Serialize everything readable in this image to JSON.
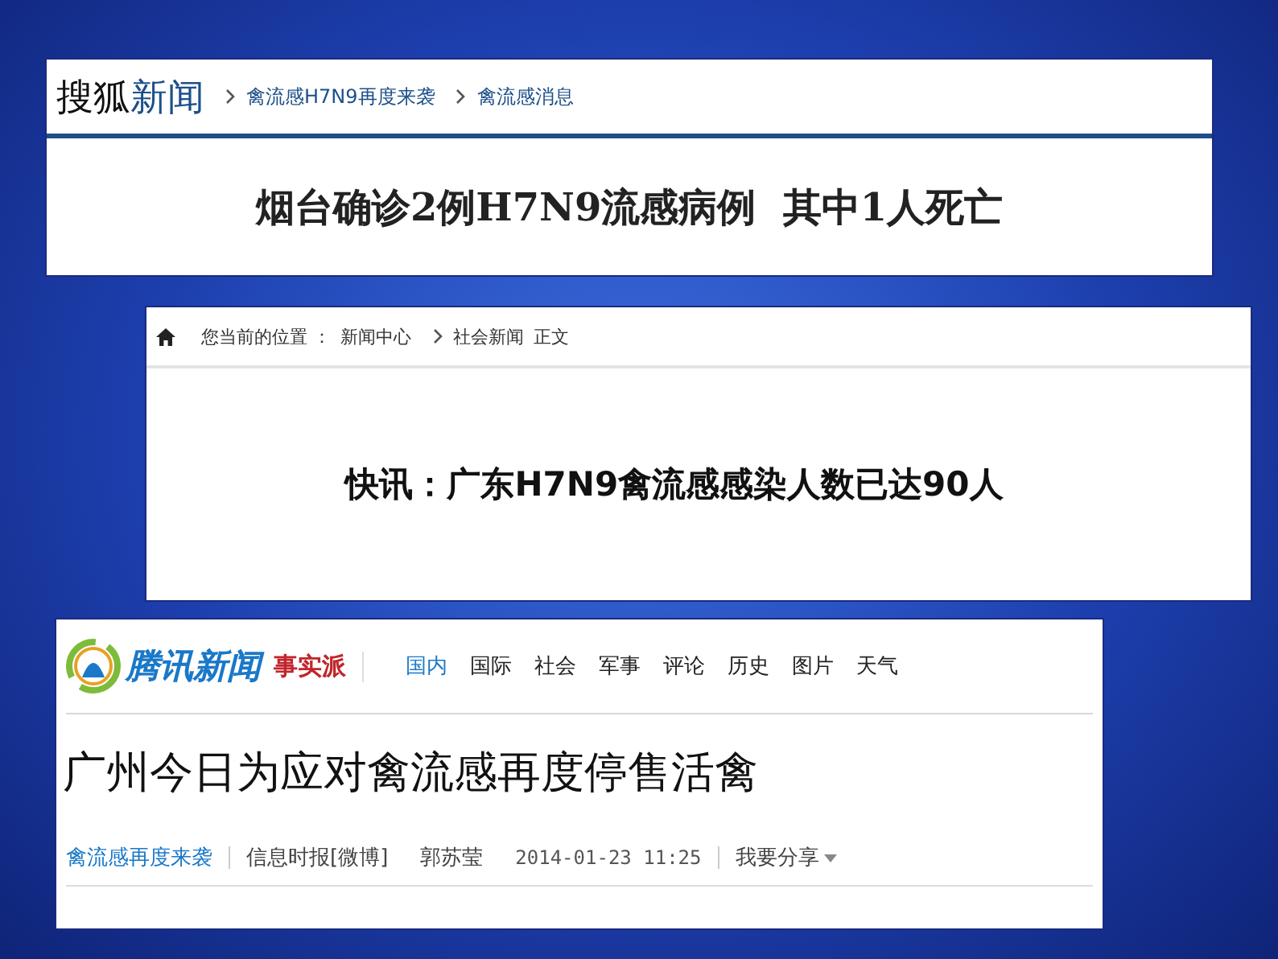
{
  "sohu_article": {
    "logo_words": [
      "搜狐",
      "新闻"
    ],
    "breadcrumbs": [
      "禽流感H7N9再度来袭",
      "禽流感消息"
    ],
    "headline": "烟台确诊2例H7N9流感病例  其中1人死亡"
  },
  "news_article": {
    "location_label": "您当前的位置 ：",
    "breadcrumbs": [
      "新闻中心",
      "社会新闻"
    ],
    "page_label": "正文",
    "headline": "快讯：广东H7N9禽流感感染人数已达90人"
  },
  "tencent_article": {
    "logo_text": "腾讯新闻",
    "column_logo": "事实派",
    "nav": [
      {
        "label": "国内",
        "selected": true
      },
      {
        "label": "国际",
        "selected": false
      },
      {
        "label": "社会",
        "selected": false
      },
      {
        "label": "军事",
        "selected": false
      },
      {
        "label": "评论",
        "selected": false
      },
      {
        "label": "历史",
        "selected": false
      },
      {
        "label": "图片",
        "selected": false
      },
      {
        "label": "天气",
        "selected": false
      }
    ],
    "headline": "广州今日为应对禽流感再度停售活禽",
    "meta": [
      {
        "kind": "link",
        "text": "禽流感再度来袭"
      },
      {
        "kind": "source",
        "text": "信息时报[微博]"
      },
      {
        "kind": "author",
        "text": "郭苏莹"
      },
      {
        "kind": "date",
        "text": "2014-01-23 11:25"
      },
      {
        "kind": "share",
        "text": "我要分享"
      }
    ]
  }
}
